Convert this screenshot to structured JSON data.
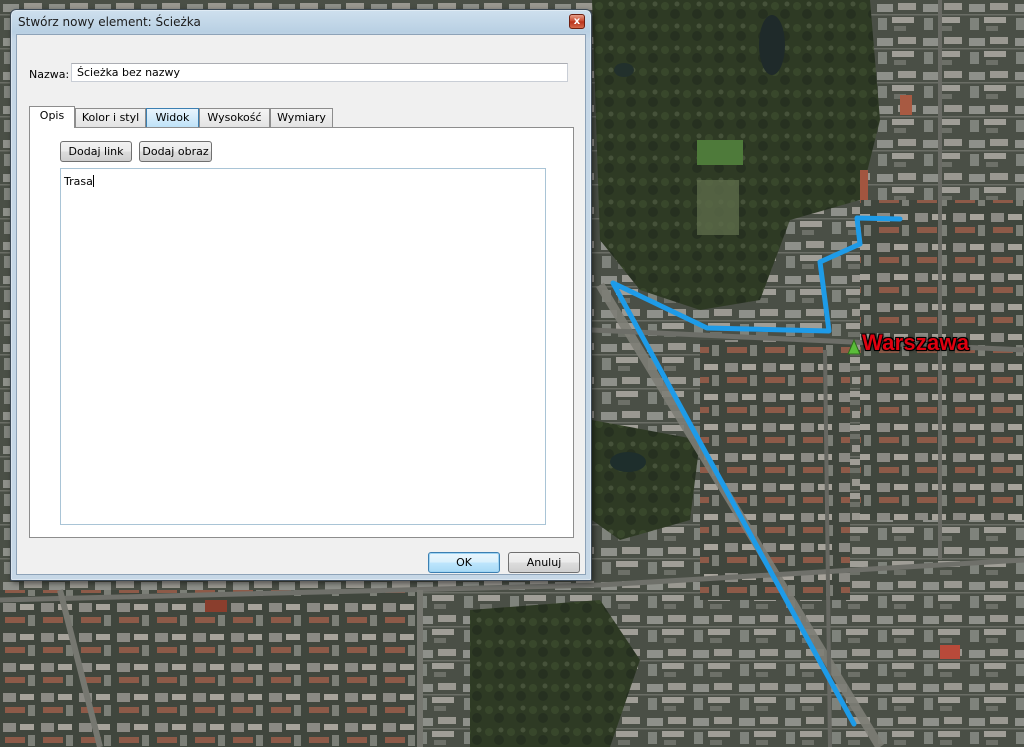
{
  "dialog": {
    "title": "Stwórz nowy element: Ścieżka",
    "close_glyph": "x",
    "name_label": "Nazwa:",
    "name_value": "Ścieżka bez nazwy",
    "tabs": [
      {
        "label": "Opis",
        "active": true
      },
      {
        "label": "Kolor i styl",
        "active": false
      },
      {
        "label": "Widok",
        "active": false
      },
      {
        "label": "Wysokość",
        "active": false
      },
      {
        "label": "Wymiary",
        "active": false
      }
    ],
    "add_link_label": "Dodaj link",
    "add_image_label": "Dodaj obraz",
    "description_value": "Trasa",
    "ok_label": "OK",
    "cancel_label": "Anuluj"
  },
  "map": {
    "place_label": "Warszawa",
    "place_label_color": "#e0000f",
    "path_color": "#1e9be8",
    "pin_color": "#5bbd3a",
    "pin_icon": "placemark-pin-icon"
  }
}
